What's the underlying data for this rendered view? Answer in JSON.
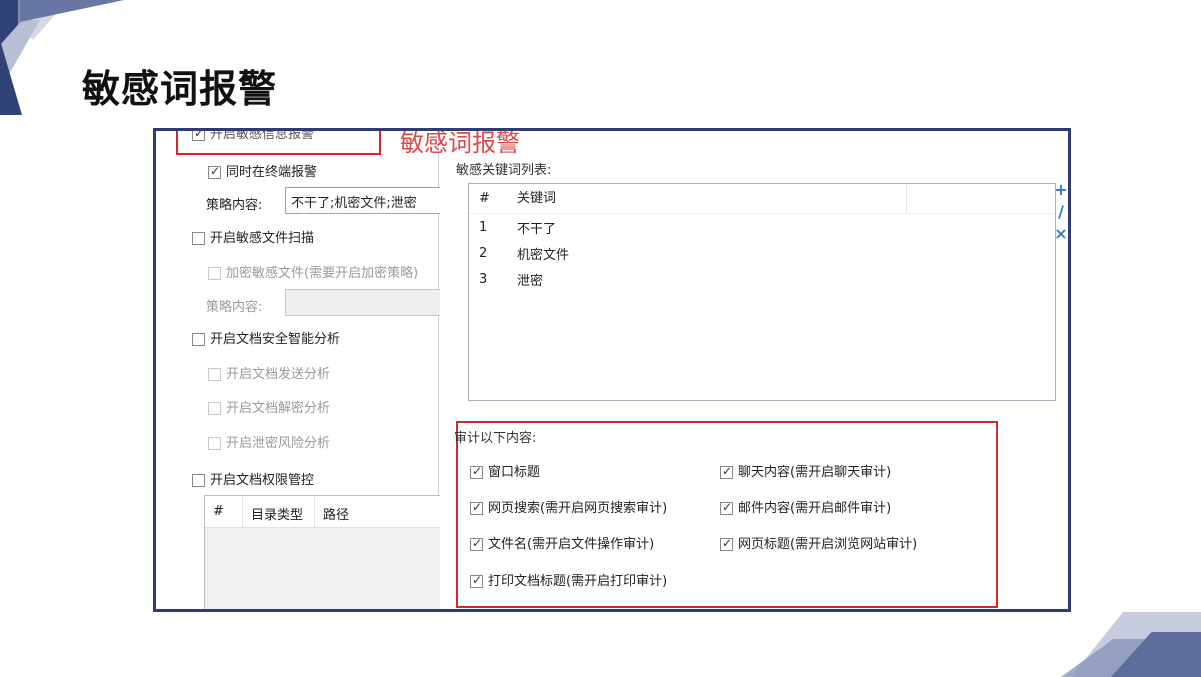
{
  "slide": {
    "title": "敏感词报警"
  },
  "left": {
    "top_cut_label": "开启敏感信息报警",
    "sync_terminal": {
      "label": "同时在终端报警",
      "checked": true
    },
    "strategy_label": "策略内容:",
    "strategy_value": "不干了;机密文件;泄密",
    "sensitive_scan": {
      "label": "开启敏感文件扫描",
      "checked": false
    },
    "encrypt_sensitive": {
      "label": "加密敏感文件(需要开启加密策略)",
      "checked": false
    },
    "strategy_label_2": "策略内容:",
    "doc_analysis": {
      "label": "开启文档安全智能分析",
      "checked": false
    },
    "doc_send": {
      "label": "开启文档发送分析",
      "checked": false
    },
    "doc_decrypt": {
      "label": "开启文档解密分析",
      "checked": false
    },
    "leak_risk": {
      "label": "开启泄密风险分析",
      "checked": false
    },
    "doc_permission": {
      "label": "开启文档权限管控",
      "checked": false
    },
    "dir_table": {
      "columns": [
        "#",
        "目录类型",
        "路径"
      ]
    }
  },
  "overlay_title": "敏感词报警",
  "right": {
    "keyword_list_label": "敏感关键词列表:",
    "keyword_table": {
      "columns": [
        "#",
        "关键词"
      ],
      "rows": [
        {
          "no": "1",
          "keyword": "不干了"
        },
        {
          "no": "2",
          "keyword": "机密文件"
        },
        {
          "no": "3",
          "keyword": "泄密"
        }
      ]
    },
    "side_icons": [
      "add-icon",
      "edit-icon",
      "delete-icon"
    ],
    "side_icon_glyphs": [
      "+",
      "/",
      "×"
    ],
    "audit_label": "审计以下内容:",
    "audit_items": [
      {
        "label": "窗口标题",
        "checked": true
      },
      {
        "label": "聊天内容(需开启聊天审计)",
        "checked": true
      },
      {
        "label": "网页搜索(需开启网页搜索审计)",
        "checked": true
      },
      {
        "label": "邮件内容(需开启邮件审计)",
        "checked": true
      },
      {
        "label": "文件名(需开启文件操作审计)",
        "checked": true
      },
      {
        "label": "网页标题(需开启浏览网站审计)",
        "checked": true
      },
      {
        "label": "打印文档标题(需开启打印审计)",
        "checked": true
      }
    ]
  },
  "colors": {
    "frame_border": "#2f3d70",
    "highlight_red": "#d22a2a",
    "overlay_red": "#e04848",
    "icon_blue": "#2f7ad1"
  }
}
